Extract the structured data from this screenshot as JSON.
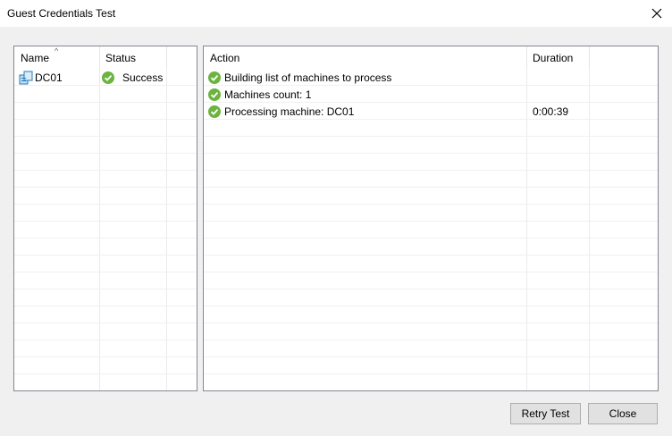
{
  "window": {
    "title": "Guest Credentials Test"
  },
  "left_table": {
    "columns": [
      "Name",
      "Status"
    ],
    "rows": [
      {
        "name": "DC01",
        "status": "Success",
        "icon": "server-icon",
        "status_icon": "check-circle-icon"
      }
    ]
  },
  "right_table": {
    "columns": [
      "Action",
      "Duration"
    ],
    "rows": [
      {
        "action": "Building list of machines to process",
        "duration": "",
        "icon": "check-circle-icon"
      },
      {
        "action": "Machines count: 1",
        "duration": "",
        "icon": "check-circle-icon"
      },
      {
        "action": "Processing machine: DC01",
        "duration": "0:00:39",
        "icon": "check-circle-icon"
      }
    ]
  },
  "buttons": {
    "retry": "Retry Test",
    "close": "Close"
  },
  "colors": {
    "success": "#6cb33f",
    "border": "#828790",
    "background": "#f0f0f0"
  }
}
